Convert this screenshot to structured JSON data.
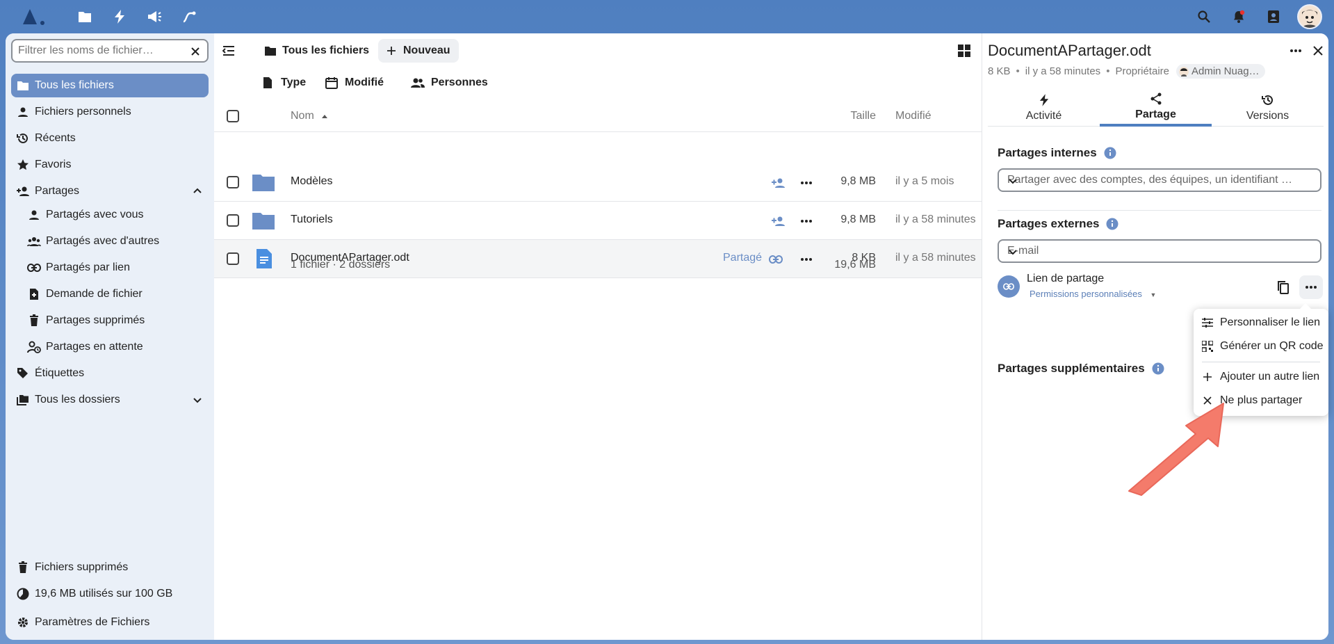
{
  "topbar": {
    "apps": [
      "files-icon",
      "activity-icon",
      "announcements-icon",
      "flow-icon"
    ],
    "right": [
      "search-icon",
      "notifications-icon",
      "contacts-icon"
    ]
  },
  "sidebar": {
    "filter_placeholder": "Filtrer les noms de fichier…",
    "items": [
      {
        "label": "Tous les fichiers",
        "icon": "folder-icon",
        "active": true
      },
      {
        "label": "Fichiers personnels",
        "icon": "user-icon"
      },
      {
        "label": "Récents",
        "icon": "history-icon"
      },
      {
        "label": "Favoris",
        "icon": "star-icon"
      },
      {
        "label": "Partages",
        "icon": "share-user-icon"
      },
      {
        "label": "Partagés avec vous",
        "icon": "user-icon"
      },
      {
        "label": "Partagés avec d'autres",
        "icon": "users-icon"
      },
      {
        "label": "Partagés par lien",
        "icon": "link-icon"
      },
      {
        "label": "Demande de fichier",
        "icon": "file-request-icon"
      },
      {
        "label": "Partages supprimés",
        "icon": "trash-icon"
      },
      {
        "label": "Partages en attente",
        "icon": "pending-user-icon"
      },
      {
        "label": "Étiquettes",
        "icon": "tags-icon"
      },
      {
        "label": "Tous les dossiers",
        "icon": "folders-icon"
      }
    ],
    "trash": "Fichiers supprimés",
    "quota": "19,6 MB utilisés sur 100 GB",
    "settings": "Paramètres de Fichiers"
  },
  "files": {
    "breadcrumb": "Tous les fichiers",
    "new_label": "Nouveau",
    "filters": [
      "Type",
      "Modifié",
      "Personnes"
    ],
    "columns": {
      "name": "Nom",
      "size": "Taille",
      "modified": "Modifié"
    },
    "rows": [
      {
        "name": "Modèles",
        "size": "9,8 MB",
        "modified": "il y a 5 mois",
        "type": "folder"
      },
      {
        "name": "Tutoriels",
        "size": "9,8 MB",
        "modified": "il y a 58 minutes",
        "type": "folder"
      },
      {
        "name": "DocumentAPartager.odt",
        "size": "8 KB",
        "modified": "il y a 58 minutes",
        "type": "document",
        "shared_label": "Partagé"
      }
    ],
    "summary": "1 fichier · 2 dossiers",
    "summary_size": "19,6 MB"
  },
  "details": {
    "title": "DocumentAPartager.odt",
    "size": "8 KB",
    "modified": "il y a 58 minutes",
    "owner_label": "Propriétaire",
    "owner_name": "Admin Nuag…",
    "tabs": [
      "Activité",
      "Partage",
      "Versions"
    ],
    "internal_title": "Partages internes",
    "internal_placeholder": "Partager avec des comptes, des équipes, un identifiant …",
    "external_title": "Partages externes",
    "external_placeholder": "E-mail",
    "link_title": "Lien de partage",
    "link_perm": "Permissions personnalisées",
    "additional_title": "Partages supplémentaires"
  },
  "menu": {
    "items": [
      "Personnaliser le lien",
      "Générer un QR code",
      "Ajouter un autre lien",
      "Ne plus partager"
    ]
  },
  "colors": {
    "accent": "#4f7fc0",
    "active_nav": "#6b8ec6",
    "arrow": "#f47b6b"
  }
}
